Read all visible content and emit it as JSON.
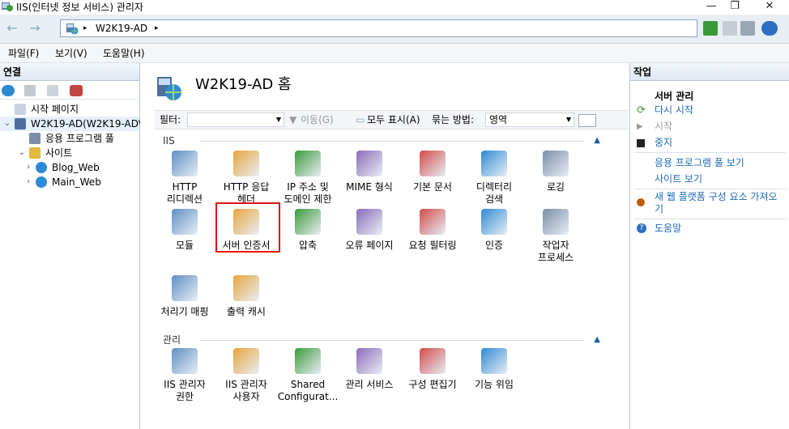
{
  "window": {
    "title": "IIS(인터넷 정보 서비스) 관리자",
    "controls": {
      "minimize": "—",
      "restore": "❐",
      "close": "✕"
    }
  },
  "address": {
    "back_glyph": "←",
    "forward_glyph": "→",
    "arrow": "▸",
    "path": "W2K19-AD"
  },
  "menu": {
    "items": [
      "파일(F)",
      "보기(V)",
      "도움말(H)"
    ]
  },
  "connections": {
    "header": "연결",
    "tree": [
      {
        "label": "시작 페이지",
        "icon": "start-page-icon",
        "level": 0,
        "toggle": ""
      },
      {
        "label": "W2K19-AD(W2K19-AD\\",
        "icon": "server-icon",
        "level": 0,
        "toggle": "⌄"
      },
      {
        "label": "응용 프로그램 풀",
        "icon": "app-pool-icon",
        "level": 1,
        "toggle": ""
      },
      {
        "label": "사이트",
        "icon": "sites-folder-icon",
        "level": 1,
        "toggle": "⌄"
      },
      {
        "label": "Blog_Web",
        "icon": "globe-icon",
        "level": 2,
        "toggle": "›"
      },
      {
        "label": "Main_Web",
        "icon": "globe-icon",
        "level": 2,
        "toggle": "›"
      }
    ]
  },
  "main": {
    "title": "W2K19-AD 홈",
    "filter": {
      "label": "필터:",
      "go_button": "이동(G)",
      "show_all_button": "모두 표시(A)",
      "group_by_label": "묶는 방법:",
      "group_by_value": "영역"
    },
    "sections": [
      {
        "name": "IIS",
        "features": [
          {
            "label": "HTTP\n리디렉션",
            "icon": "http-redirect-icon"
          },
          {
            "label": "HTTP 응답\n헤더",
            "icon": "http-headers-icon"
          },
          {
            "label": "IP 주소 및\n도메인 제한",
            "icon": "ip-restrictions-icon"
          },
          {
            "label": "MIME 형식",
            "icon": "mime-types-icon"
          },
          {
            "label": "기본 문서",
            "icon": "default-document-icon"
          },
          {
            "label": "디렉터리\n검색",
            "icon": "directory-browsing-icon"
          },
          {
            "label": "로깅",
            "icon": "logging-icon"
          },
          {
            "label": "모듈",
            "icon": "modules-icon"
          },
          {
            "label": "서버 인증서",
            "icon": "server-certificates-icon"
          },
          {
            "label": "압축",
            "icon": "compression-icon"
          },
          {
            "label": "오류 페이지",
            "icon": "error-pages-icon"
          },
          {
            "label": "요청 필터링",
            "icon": "request-filtering-icon"
          },
          {
            "label": "인증",
            "icon": "authentication-icon"
          },
          {
            "label": "작업자\n프로세스",
            "icon": "worker-processes-icon"
          },
          {
            "label": "처리기 매핑",
            "icon": "handler-mappings-icon"
          },
          {
            "label": "출력 캐시",
            "icon": "output-caching-icon"
          }
        ]
      },
      {
        "name": "관리",
        "features": [
          {
            "label": "IIS 관리자\n권한",
            "icon": "manager-permissions-icon"
          },
          {
            "label": "IIS 관리자\n사용자",
            "icon": "manager-users-icon"
          },
          {
            "label": "Shared\nConfigurat...",
            "icon": "shared-configuration-icon"
          },
          {
            "label": "관리 서비스",
            "icon": "management-service-icon"
          },
          {
            "label": "구성 편집기",
            "icon": "configuration-editor-icon"
          },
          {
            "label": "기능 위임",
            "icon": "feature-delegation-icon"
          }
        ]
      }
    ]
  },
  "actions": {
    "header": "작업",
    "group_title": "서버 관리",
    "items": {
      "restart": "다시 시작",
      "start": "시작",
      "stop": "중지",
      "view_app_pools": "응용 프로그램 풀 보기",
      "view_sites": "사이트 보기",
      "get_new_components": "새 웹 플랫폼 구성 요소 가져오기",
      "help": "도움말"
    }
  },
  "colors": {
    "link": "#1f6bb8",
    "highlight_box": "#e01010",
    "panel_border": "#b9c6d4"
  }
}
